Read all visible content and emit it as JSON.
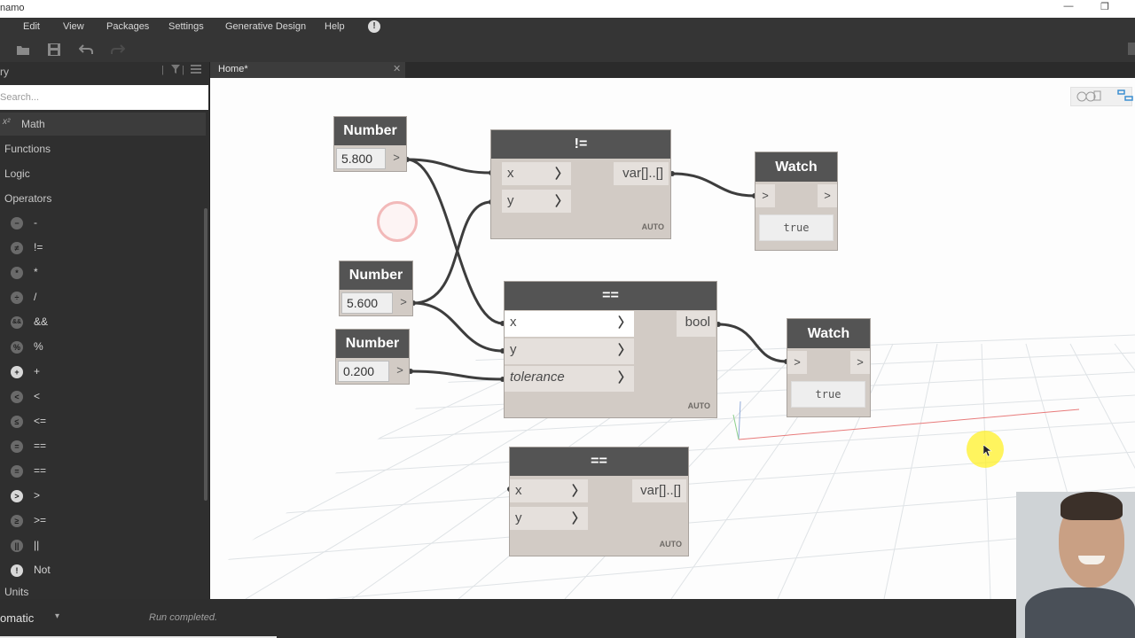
{
  "window": {
    "title": "namo",
    "minimize": "—",
    "restore": "❐"
  },
  "menu": [
    "Edit",
    "View",
    "Packages",
    "Settings",
    "Generative Design",
    "Help"
  ],
  "menu_alert": "!",
  "library": {
    "title": "ry",
    "search_placeholder": "Search...",
    "categories": [
      "Math",
      "Functions",
      "Logic",
      "Operators",
      "Units"
    ],
    "math_prefix": "x²",
    "operators": [
      {
        "icon": "−",
        "label": "-"
      },
      {
        "icon": "≠",
        "label": "!="
      },
      {
        "icon": "*",
        "label": "*"
      },
      {
        "icon": "÷",
        "label": "/"
      },
      {
        "icon": "&&",
        "label": "&&"
      },
      {
        "icon": "%",
        "label": "%"
      },
      {
        "icon": "+",
        "label": "+"
      },
      {
        "icon": "<",
        "label": "<"
      },
      {
        "icon": "≤",
        "label": "<="
      },
      {
        "icon": "=",
        "label": "=="
      },
      {
        "icon": "=",
        "label": "=="
      },
      {
        "icon": ">",
        "label": ">"
      },
      {
        "icon": "≥",
        "label": ">="
      },
      {
        "icon": "||",
        "label": "||"
      },
      {
        "icon": "!",
        "label": "Not"
      }
    ]
  },
  "tab": {
    "label": "Home*",
    "close": "✕"
  },
  "nodes": {
    "number1": {
      "title": "Number",
      "value": "5.800",
      "arrow": ">"
    },
    "number2": {
      "title": "Number",
      "value": "5.600",
      "arrow": ">"
    },
    "number3": {
      "title": "Number",
      "value": "0.200",
      "arrow": ">"
    },
    "notequal": {
      "title": "!=",
      "in": [
        "x",
        "y"
      ],
      "out": "var[]..[]",
      "lacing": "AUTO",
      "arrow": "〉"
    },
    "equal1": {
      "title": "==",
      "in": [
        "x",
        "y",
        "tolerance"
      ],
      "out": "bool",
      "lacing": "AUTO",
      "arrow": "〉"
    },
    "equal2": {
      "title": "==",
      "in": [
        "x",
        "y"
      ],
      "out": "var[]..[]",
      "lacing": "AUTO",
      "arrow": "〉"
    },
    "watch1": {
      "title": "Watch",
      "in": ">",
      "out": ">",
      "value": "true"
    },
    "watch2": {
      "title": "Watch",
      "in": ">",
      "out": ">",
      "value": "true"
    }
  },
  "status": {
    "mode": "omatic",
    "caret": "▾",
    "message": "Run completed."
  },
  "colors": {
    "node_header": "#545454",
    "node_body": "#d2cbc5",
    "wire": "#3d3d3d",
    "accent": "#3d8fd1"
  }
}
